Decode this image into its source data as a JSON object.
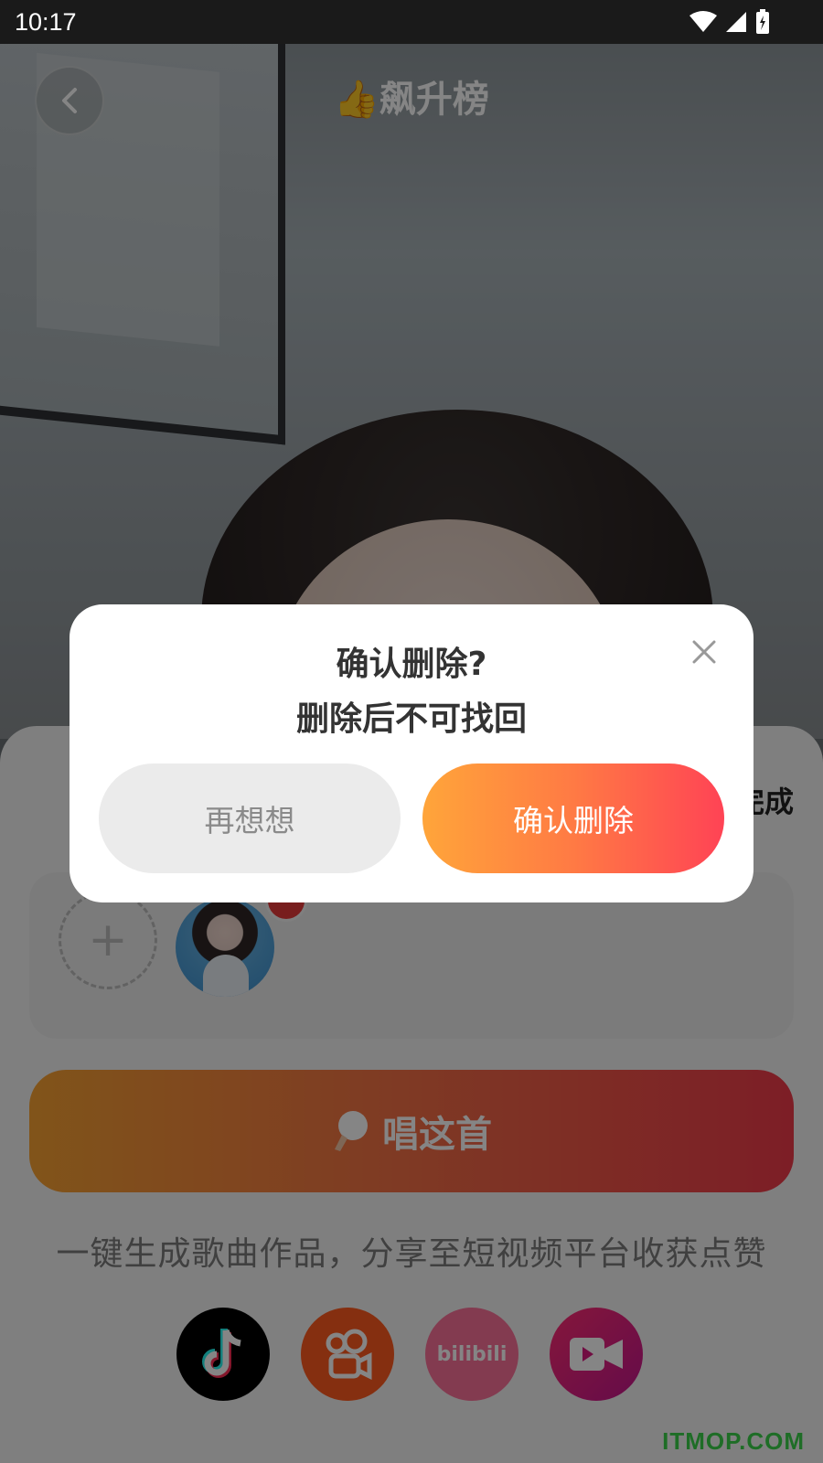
{
  "status_bar": {
    "time": "10:17"
  },
  "header": {
    "title": "👍飙升榜"
  },
  "sheet": {
    "done_label": "完成",
    "add_singer_symbol": "+",
    "remove_symbol": "−",
    "sing_button_label": "唱这首",
    "tagline": "一键生成歌曲作品，分享至短视频平台收获点赞",
    "platforms": [
      {
        "icon": "tiktok-icon"
      },
      {
        "icon": "kuaishou-icon"
      },
      {
        "icon": "bilibili-icon",
        "label": "bilibili"
      },
      {
        "icon": "video-camera-icon"
      }
    ]
  },
  "dialog": {
    "title": "确认删除?",
    "subtitle": "删除后不可找回",
    "cancel_label": "再想想",
    "confirm_label": "确认删除"
  },
  "watermark": "ITMOP.COM",
  "colors": {
    "accent_start": "#ffa53a",
    "accent_end": "#ff4355",
    "watermark": "#3ad24a"
  }
}
